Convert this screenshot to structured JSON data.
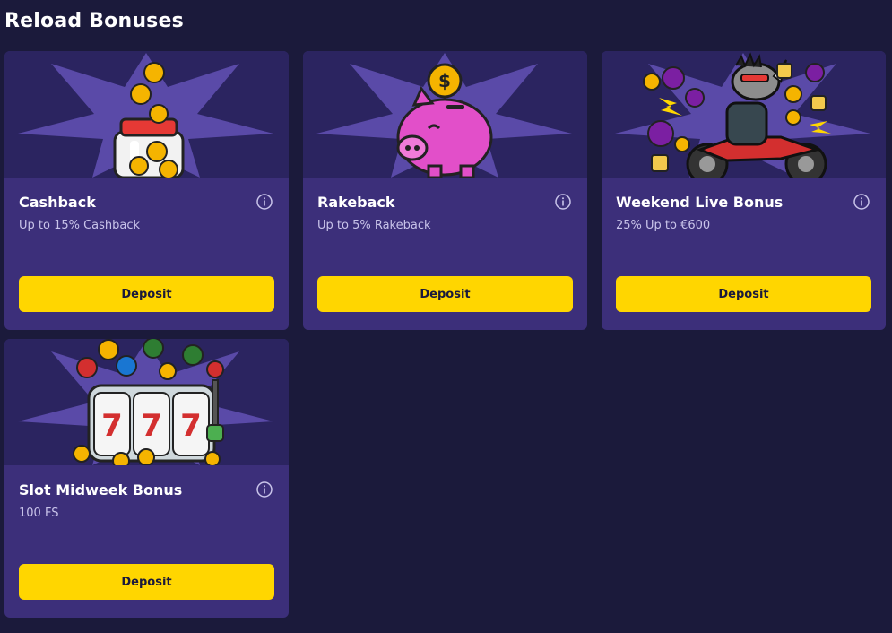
{
  "page": {
    "title": "Reload Bonuses"
  },
  "bonuses": [
    {
      "title": "Cashback",
      "subtitle": "Up to 15% Cashback",
      "button_label": "Deposit",
      "image_icon": "coin-jar-icon"
    },
    {
      "title": "Rakeback",
      "subtitle": "Up to 5% Rakeback",
      "button_label": "Deposit",
      "image_icon": "piggy-bank-icon"
    },
    {
      "title": "Weekend Live Bonus",
      "subtitle": "25% Up to €600",
      "button_label": "Deposit",
      "image_icon": "rhino-motorcycle-icon"
    },
    {
      "title": "Slot Midweek Bonus",
      "subtitle": "100 FS",
      "button_label": "Deposit",
      "image_icon": "slot-machine-icon"
    }
  ],
  "colors": {
    "background": "#1b1a3b",
    "card": "#3c2f7a",
    "card_image_bg": "#2b2460",
    "button": "#ffd600",
    "button_text": "#1b1a3b",
    "title_text": "#ffffff",
    "subtitle_text": "#c9c4ea"
  }
}
